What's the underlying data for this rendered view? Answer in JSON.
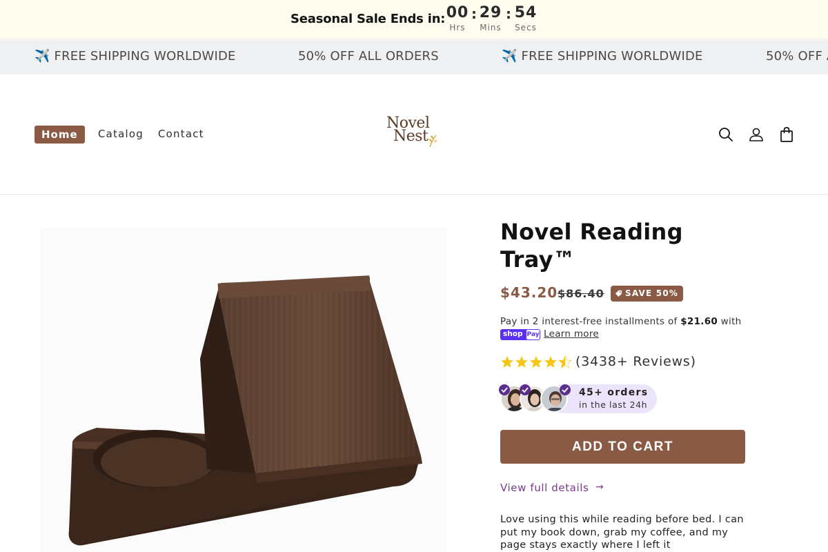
{
  "countdown": {
    "label": "Seasonal Sale Ends in:",
    "hours": "00",
    "hours_label": "Hrs",
    "minutes": "29",
    "minutes_label": "Mins",
    "seconds": "54",
    "seconds_label": "Secs",
    "separator": ":"
  },
  "marquee": {
    "items": [
      "✈️ FREE SHIPPING WORLDWIDE",
      "50% OFF ALL ORDERS",
      "✈️ FREE SHIPPING WORLDWIDE",
      "50% OFF A"
    ]
  },
  "nav": {
    "home": "Home",
    "catalog": "Catalog",
    "contact": "Contact"
  },
  "logo": {
    "line1": "Novel",
    "line2": "Nest"
  },
  "header_icons": [
    "search-icon",
    "account-icon",
    "cart-icon"
  ],
  "product": {
    "title": "Novel Reading Tray™",
    "price": "$43.20",
    "compare_price": "$86.40",
    "save_badge": "SAVE 50%",
    "installments_prefix": "Pay in 2 interest-free installments of ",
    "installment_amount": "$21.60",
    "installments_suffix": " with",
    "shop_pay_shop": "shop",
    "shop_pay_pay": "Pay",
    "learn_more": "Learn more",
    "rating": 4.5,
    "reviews": "(3438+ Reviews)",
    "orders_title": "45+ orders",
    "orders_sub": "in the last 24h",
    "add_to_cart": "ADD TO CART",
    "view_details": "View full details",
    "view_arrow": "→",
    "testimonial": "Love using this while reading before bed. I can put my book down, grab my coffee, and my page stays exactly where I left it"
  },
  "colors": {
    "accent": "#8a5a44",
    "countdown_bg": "#fdfcef",
    "marquee_bg": "#eef0f1",
    "orders_pill_bg": "#ece4fb",
    "verified_purple": "#5b2d8e",
    "link_purple": "#7a3a8a",
    "star_yellow": "#f5c518"
  }
}
